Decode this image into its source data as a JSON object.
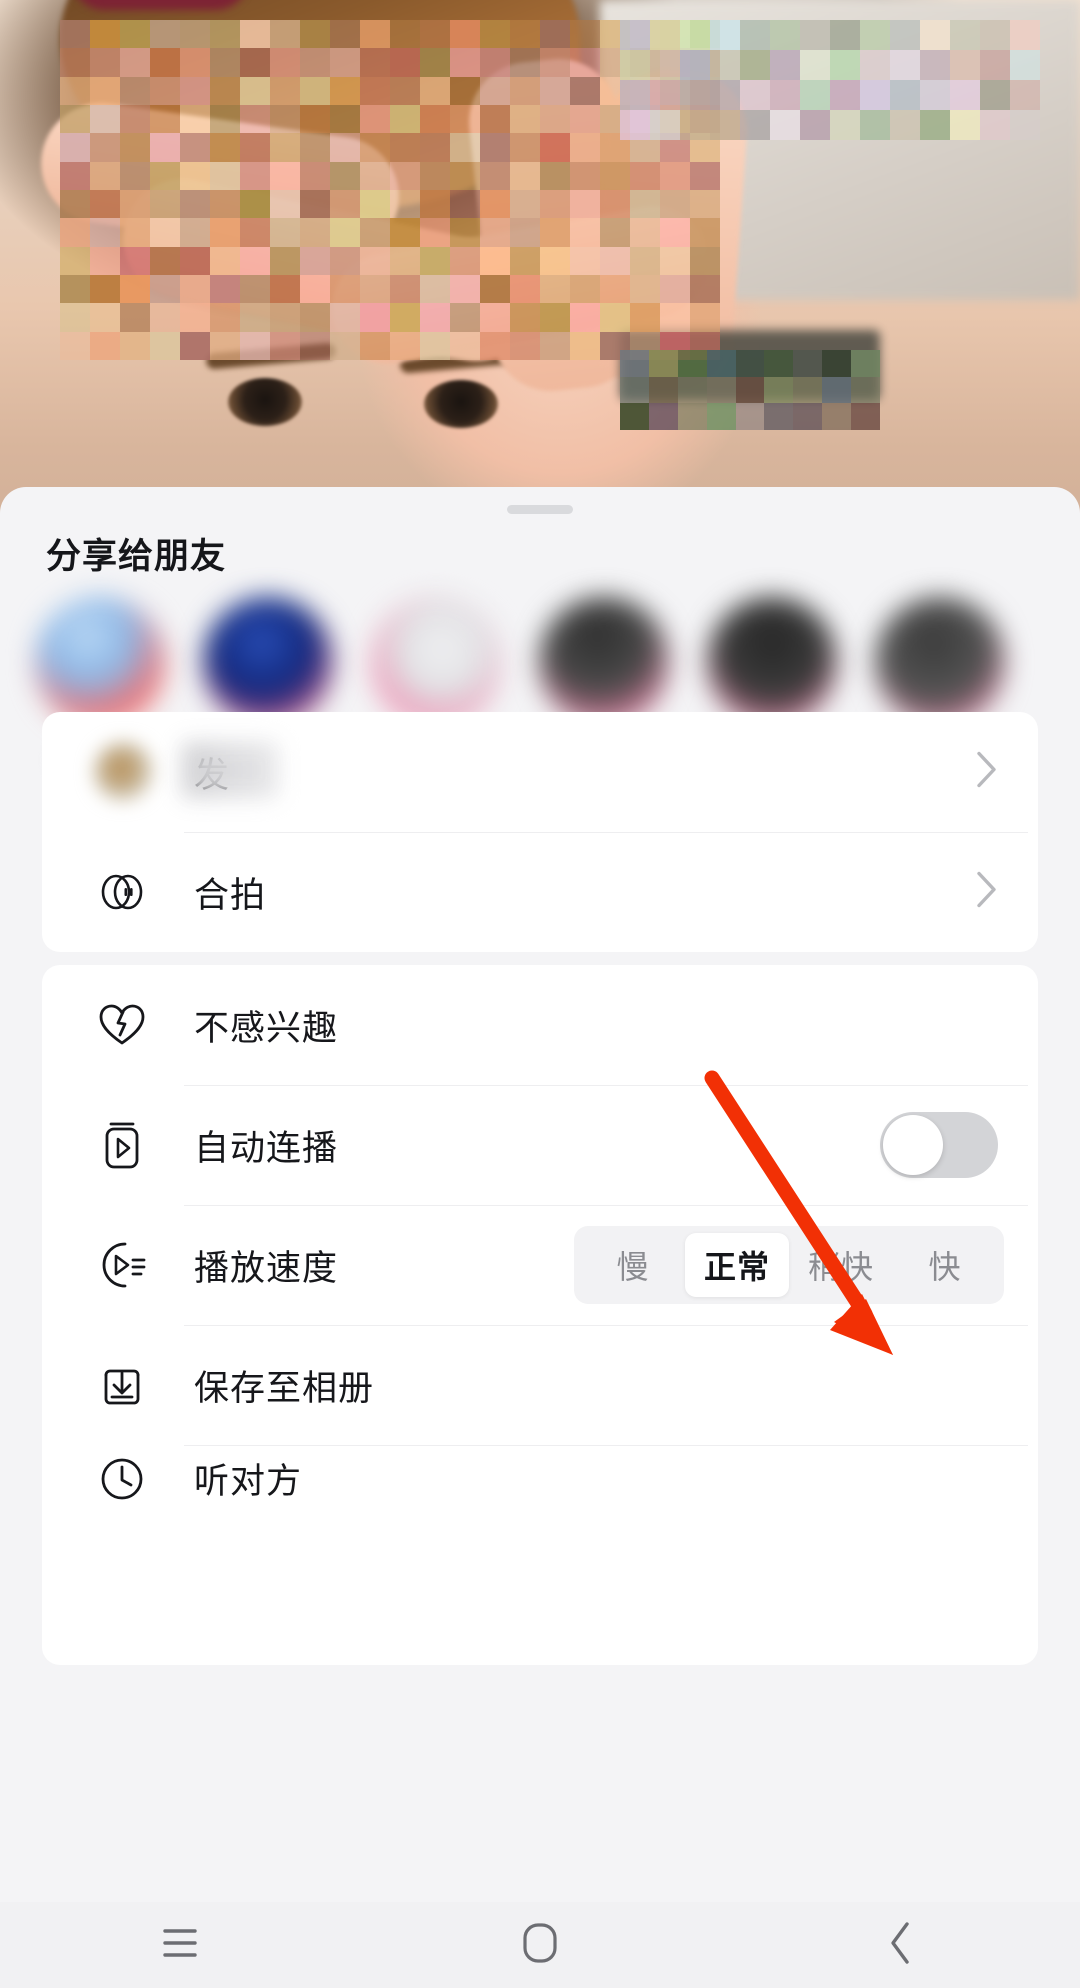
{
  "video": {
    "description": "blurred-pixelated-person-making-heart-gesture"
  },
  "sheet": {
    "title": "分享给朋友",
    "drag_handle": "drag-handle",
    "share_targets": [
      {
        "name": "",
        "avatar_color": "#7fb0e8"
      },
      {
        "name": "",
        "avatar_color": "#1b3fa0"
      },
      {
        "name": "",
        "avatar_color": "#e8e8ea"
      },
      {
        "name": "",
        "avatar_color": "#3a3a3a"
      },
      {
        "name": "",
        "avatar_color": "#2e2e2e"
      },
      {
        "name": "",
        "avatar_color": "#4a4a4a"
      }
    ],
    "card_one": {
      "rows": [
        {
          "label": "发",
          "icon": "blurred-avatar-icon",
          "accessory": "chevron",
          "blurred": true
        },
        {
          "label": "合拍",
          "icon": "duet-circles-icon",
          "accessory": "chevron",
          "blurred": false
        }
      ]
    },
    "card_two": {
      "rows": [
        {
          "label": "不感兴趣",
          "icon": "broken-heart-icon",
          "accessory": "none"
        },
        {
          "label": "自动连播",
          "icon": "autoplay-video-icon",
          "accessory": "toggle",
          "toggle_on": false
        },
        {
          "label": "播放速度",
          "icon": "playback-speed-icon",
          "accessory": "segmented",
          "options": [
            "慢",
            "正常",
            "稍快",
            "快"
          ],
          "selected": "正常"
        },
        {
          "label": "保存至相册",
          "icon": "download-to-album-icon",
          "accessory": "none"
        },
        {
          "label": "听对方",
          "icon": "clock-icon",
          "accessory": "none",
          "cutoff": true
        }
      ]
    }
  },
  "annotation": {
    "type": "red-arrow",
    "color": "#f23005",
    "points_to": "自动连播 toggle"
  },
  "navbar": {
    "buttons": [
      {
        "name": "recents",
        "glyph": "menu-lines-icon"
      },
      {
        "name": "home",
        "glyph": "home-rounded-square-icon"
      },
      {
        "name": "back",
        "glyph": "chevron-left-icon"
      }
    ]
  },
  "colors": {
    "sheet_bg": "#f4f4f6",
    "card_bg": "#ffffff",
    "text_primary": "#16171b",
    "text_muted": "#8b8c91",
    "accent_red": "#f23005",
    "toggle_off": "#d3d4d7"
  }
}
